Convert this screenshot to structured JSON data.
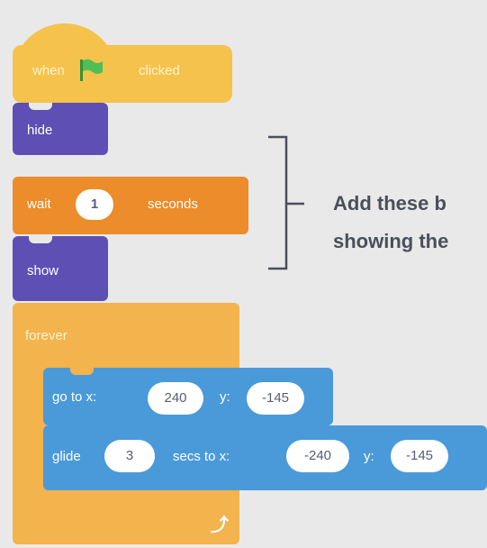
{
  "script": {
    "when_flag": {
      "before": "when",
      "after": "clicked",
      "icon": "green-flag-icon"
    },
    "hide": "hide",
    "wait": {
      "label": "wait",
      "value": "1",
      "unit": "seconds"
    },
    "show": "show",
    "forever": "forever",
    "goto": {
      "label": "go to x:",
      "x": "240",
      "ylabel": "y:",
      "y": "-145"
    },
    "glide": {
      "label": "glide",
      "secs": "3",
      "mid": "secs to x:",
      "x": "-240",
      "ylabel": "y:",
      "y": "-145"
    },
    "loop_icon": "loop-arrow-icon"
  },
  "callout": {
    "line1": "Add these b",
    "line2": "showing the"
  },
  "colors": {
    "events": "#f5c24c",
    "looks": "#5e4fb4",
    "control_wait": "#ec8c2a",
    "control_forever": "#f3b34d",
    "motion": "#4a9ad9"
  }
}
